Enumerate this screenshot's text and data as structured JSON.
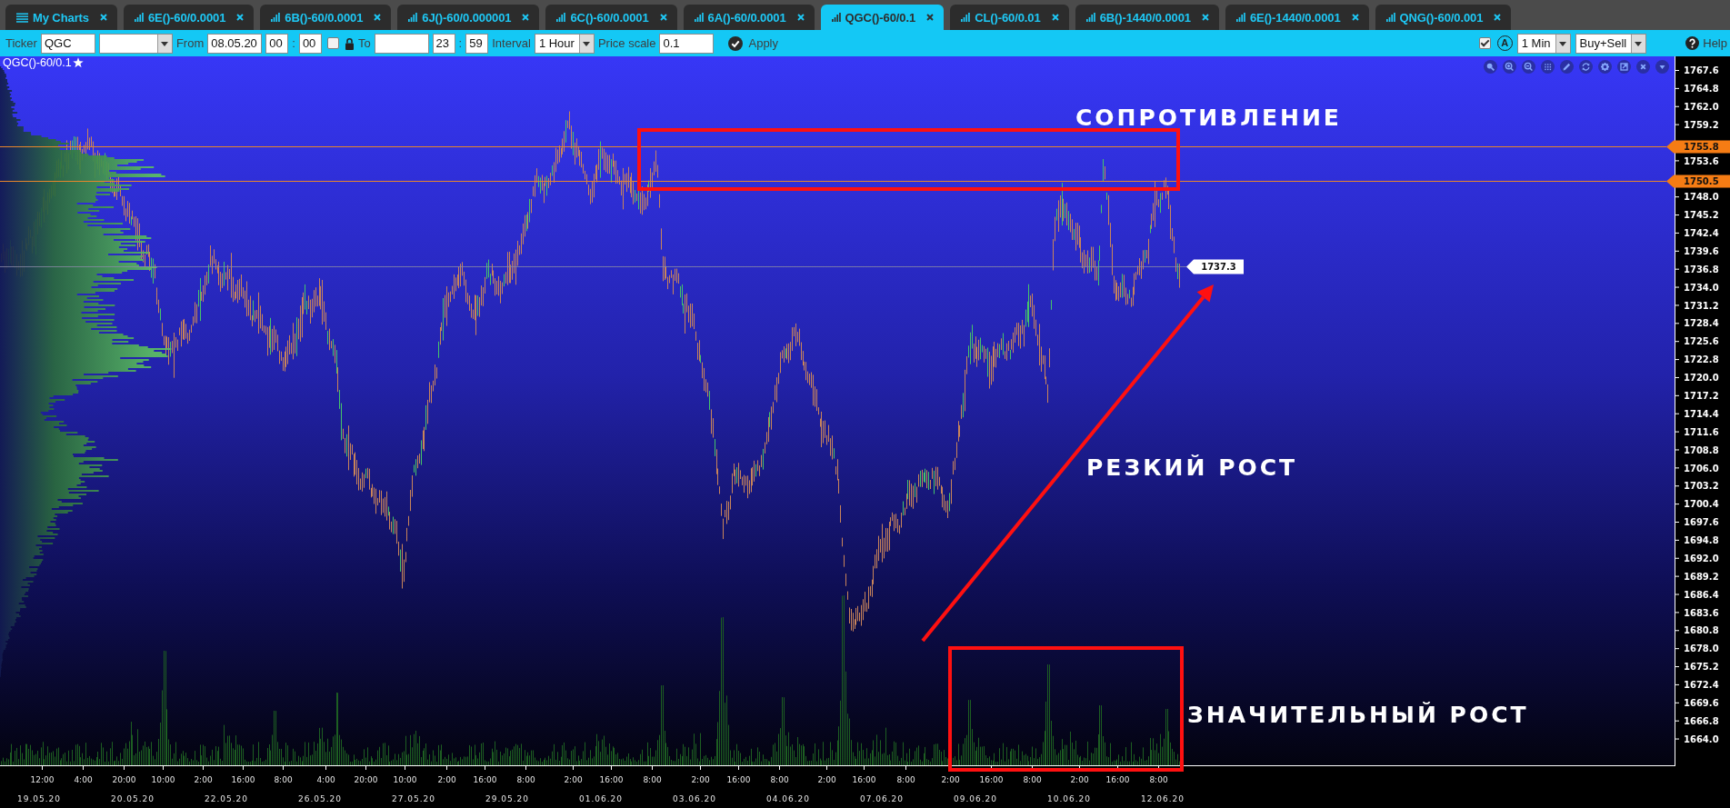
{
  "tabs": [
    {
      "label": "My Charts",
      "kind": "list",
      "selected": false
    },
    {
      "label": "6E()-60/0.0001",
      "kind": "chart",
      "selected": false
    },
    {
      "label": "6B()-60/0.0001",
      "kind": "chart",
      "selected": false
    },
    {
      "label": "6J()-60/0.000001",
      "kind": "chart",
      "selected": false
    },
    {
      "label": "6C()-60/0.0001",
      "kind": "chart",
      "selected": false
    },
    {
      "label": "6A()-60/0.0001",
      "kind": "chart",
      "selected": false
    },
    {
      "label": "QGC()-60/0.1",
      "kind": "chart",
      "selected": true
    },
    {
      "label": "CL()-60/0.01",
      "kind": "chart",
      "selected": false
    },
    {
      "label": "6B()-1440/0.0001",
      "kind": "chart",
      "selected": false
    },
    {
      "label": "6E()-1440/0.0001",
      "kind": "chart",
      "selected": false
    },
    {
      "label": "QNG()-60/0.001",
      "kind": "chart",
      "selected": false
    }
  ],
  "toolbar": {
    "left": [
      {
        "kind": "label",
        "text": "Ticker"
      },
      {
        "kind": "input",
        "value": "QGC"
      },
      {
        "kind": "select"
      },
      {
        "kind": "label",
        "text": "From"
      },
      {
        "kind": "input",
        "value": "08.05.20"
      },
      {
        "kind": "time_input",
        "value": "00"
      },
      {
        "kind": "separator",
        "text": ":"
      },
      {
        "kind": "time_input",
        "value": "00"
      },
      {
        "kind": "checkbox",
        "checked": false
      },
      {
        "kind": "lock"
      },
      {
        "kind": "label",
        "text": "To"
      },
      {
        "kind": "input"
      },
      {
        "kind": "time_input",
        "value": "23"
      },
      {
        "kind": "separator",
        "text": ":"
      },
      {
        "kind": "time_input",
        "value": "59"
      },
      {
        "kind": "label",
        "text": "Interval"
      },
      {
        "kind": "select",
        "value": "1 Hour"
      },
      {
        "kind": "label",
        "text": "Price scale"
      },
      {
        "kind": "input",
        "value": "0.1"
      },
      {
        "kind": "apply",
        "text": "Apply"
      }
    ],
    "right": [
      {
        "kind": "checkbox",
        "checked": true
      },
      {
        "kind": "letter_toggle",
        "text": "A"
      },
      {
        "kind": "select",
        "value": "1 Min"
      },
      {
        "kind": "select",
        "value": "Buy+Sell"
      },
      {
        "kind": "help",
        "text": "Help"
      }
    ]
  },
  "chart": {
    "title": "QGC()-60/0.1",
    "price_axis": [
      "1767.6",
      "1764.8",
      "1762.0",
      "1759.2",
      "1753.6",
      "1748.0",
      "1745.2",
      "1742.4",
      "1739.6",
      "1736.8",
      "1734.0",
      "1731.2",
      "1728.4",
      "1725.6",
      "1722.8",
      "1720.0",
      "1717.2",
      "1714.4",
      "1711.6",
      "1708.8",
      "1706.0",
      "1703.2",
      "1700.4",
      "1697.6",
      "1694.8",
      "1692.0",
      "1689.2",
      "1686.4",
      "1683.6",
      "1680.8",
      "1678.0",
      "1675.2",
      "1672.4",
      "1669.6",
      "1666.8",
      "1664.0"
    ],
    "levels": [
      "1755.8",
      "1750.5"
    ],
    "last_price": "1737.3",
    "time_axis": {
      "times": [
        "12:00",
        "4:00",
        "20:00",
        "10:00",
        "2:00",
        "16:00",
        "8:00",
        "4:00",
        "20:00",
        "10:00",
        "2:00",
        "16:00",
        "8:00",
        "2:00",
        "16:00",
        "8:00",
        "2:00",
        "16:00",
        "8:00",
        "2:00",
        "16:00",
        "8:00",
        "2:00",
        "16:00",
        "8:00",
        "2:00",
        "16:00",
        "8:00"
      ],
      "dates": [
        "19.05.20",
        "20.05.20",
        "22.05.20",
        "26.05.20",
        "27.05.20",
        "29.05.20",
        "01.06.20",
        "03.06.20",
        "04.06.20",
        "07.06.20",
        "09.06.20",
        "10.06.20",
        "12.06.20"
      ]
    },
    "annotations": [
      {
        "kind": "rectangle"
      },
      {
        "kind": "text",
        "text": "СОПРОТИВЛЕНИЕ"
      },
      {
        "kind": "arrow"
      },
      {
        "kind": "text",
        "text": "РЕЗКИЙ РОСТ"
      },
      {
        "kind": "rectangle"
      },
      {
        "kind": "text",
        "text": "ЗНАЧИТЕЛЬНЫЙ РОСТ"
      }
    ]
  }
}
